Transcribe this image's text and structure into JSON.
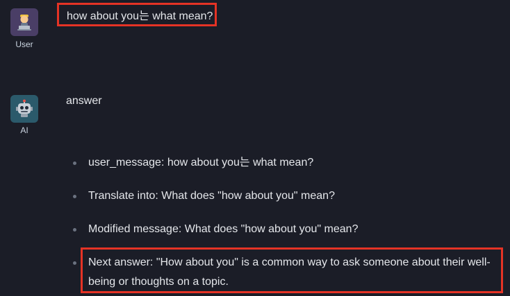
{
  "conversation": {
    "user": {
      "role_label": "User",
      "avatar_icon": "person-with-laptop-icon",
      "message": "how about you는 what mean?"
    },
    "ai": {
      "role_label": "AI",
      "avatar_icon": "robot-icon",
      "answer_title": "answer",
      "items": [
        "user_message: how about you는 what mean?",
        "Translate into: What does \"how about you\" mean?",
        "Modified message: What does \"how about you\" mean?",
        "Next answer: \"How about you\" is a common way to ask someone about their well-being or thoughts on a topic."
      ]
    }
  },
  "colors": {
    "background": "#1b1d27",
    "highlight": "#e53325",
    "user_avatar_bg": "#4a3e66",
    "ai_avatar_bg": "#2b5a6b"
  }
}
